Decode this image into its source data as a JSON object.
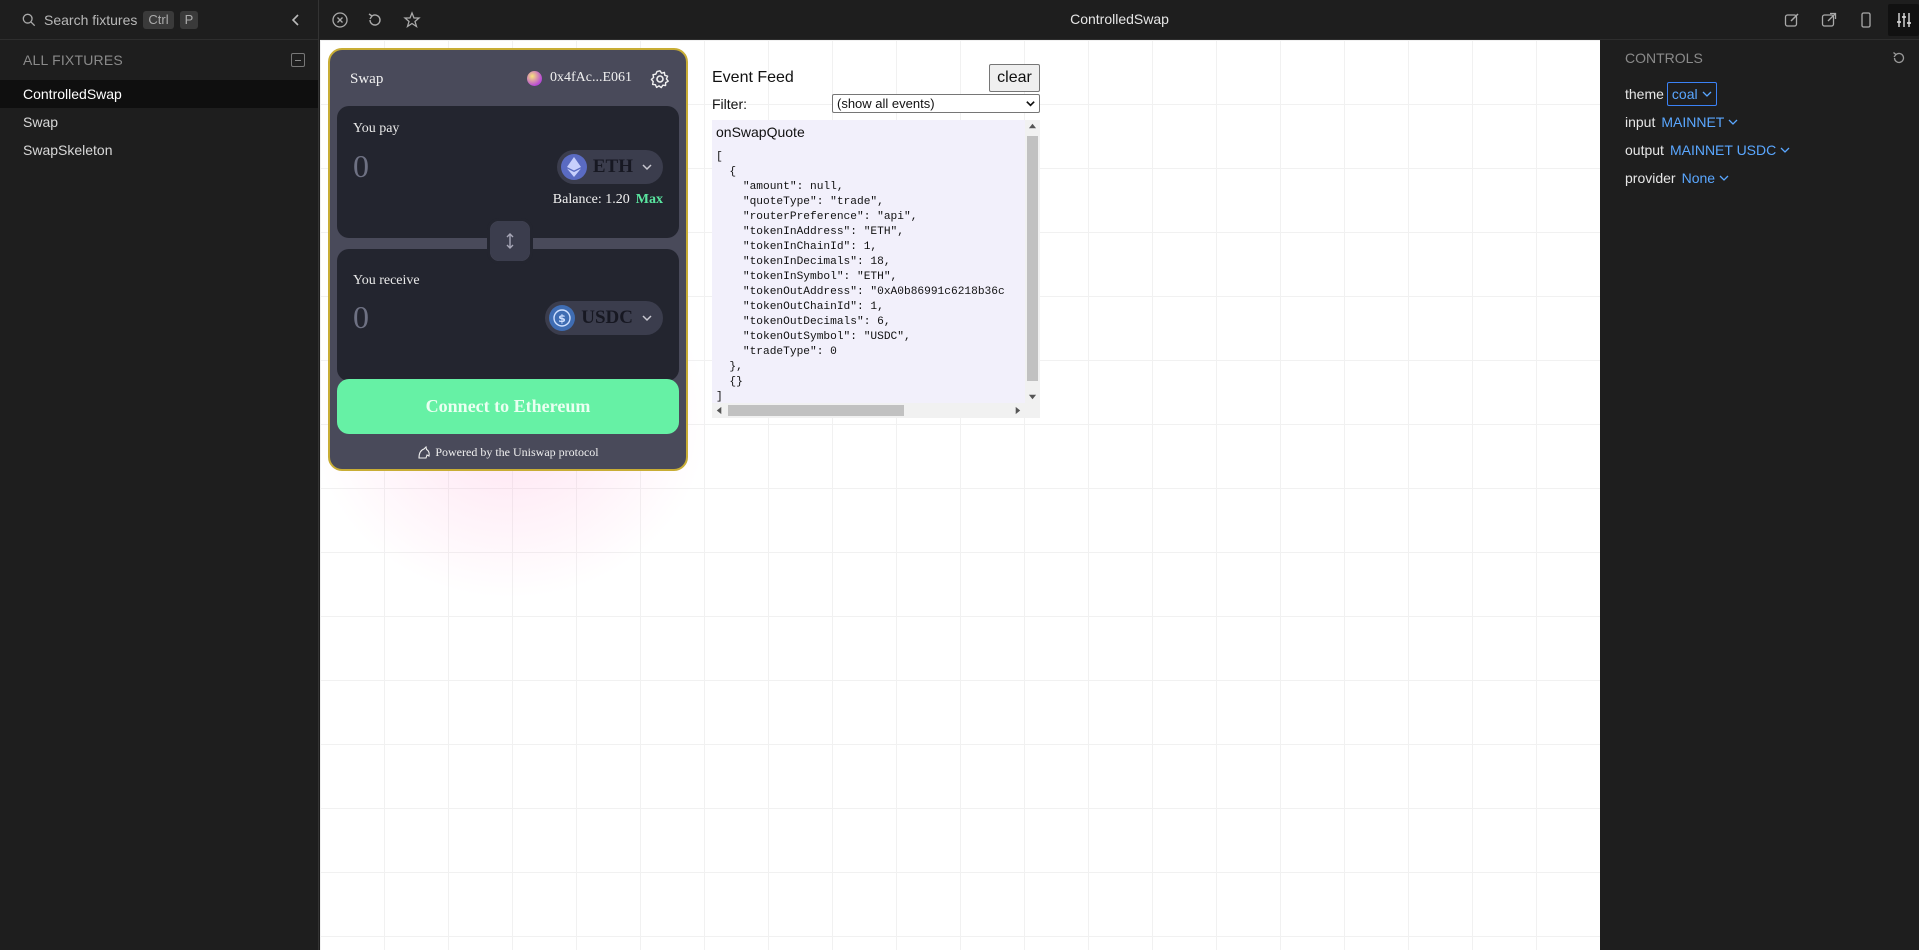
{
  "sidebar": {
    "search_placeholder": "Search fixtures",
    "shortcut_keys": [
      "Ctrl",
      "P"
    ],
    "section_title": "ALL FIXTURES",
    "fixtures": [
      {
        "label": "ControlledSwap",
        "selected": true
      },
      {
        "label": "Swap",
        "selected": false
      },
      {
        "label": "SwapSkeleton",
        "selected": false
      }
    ]
  },
  "toolbar": {
    "title": "ControlledSwap",
    "icons": [
      "close-fixture-icon",
      "reload-icon",
      "star-icon",
      "edit-icon",
      "open-new-tab-icon",
      "responsive-preview-icon",
      "controls-panel-icon"
    ]
  },
  "swap": {
    "header": "Swap",
    "wallet_address": "0x4fAc...E061",
    "pay": {
      "label": "You pay",
      "amount": "0",
      "token": "ETH",
      "balance_text": "Balance: 1.20",
      "max_label": "Max"
    },
    "receive": {
      "label": "You receive",
      "amount": "0",
      "token": "USDC"
    },
    "connect_label": "Connect to Ethereum",
    "powered_by": "Powered by the Uniswap protocol",
    "colors": {
      "accent": "#66f1a5",
      "border": "#c8ad35",
      "module": "#23252f",
      "container": "#494a5a"
    }
  },
  "event_feed": {
    "title": "Event Feed",
    "clear_label": "clear",
    "filter_label": "Filter:",
    "filter_value": "(show all events)",
    "log_title": "onSwapQuote",
    "log_lines": [
      "[",
      "  {",
      "    \"amount\": null,",
      "    \"quoteType\": \"trade\",",
      "    \"routerPreference\": \"api\",",
      "    \"tokenInAddress\": \"ETH\",",
      "    \"tokenInChainId\": 1,",
      "    \"tokenInDecimals\": 18,",
      "    \"tokenInSymbol\": \"ETH\",",
      "    \"tokenOutAddress\": \"0xA0b86991c6218b36c",
      "    \"tokenOutChainId\": 1,",
      "    \"tokenOutDecimals\": 6,",
      "    \"tokenOutSymbol\": \"USDC\",",
      "    \"tradeType\": 0",
      "  },",
      "  {}",
      "]"
    ]
  },
  "controls": {
    "title": "CONTROLS",
    "rows": [
      {
        "name": "theme",
        "value": "coal"
      },
      {
        "name": "input",
        "value": "MAINNET"
      },
      {
        "name": "output",
        "value": "MAINNET USDC"
      },
      {
        "name": "provider",
        "value": "None"
      }
    ]
  }
}
